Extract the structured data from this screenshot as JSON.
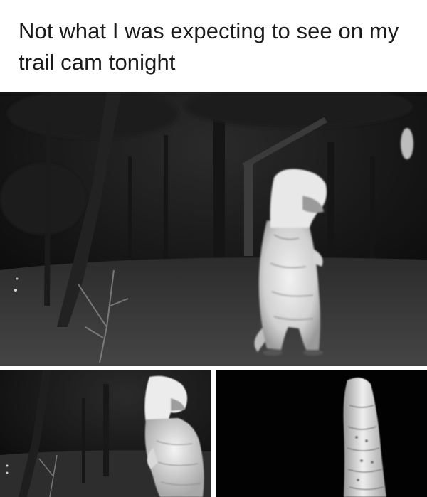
{
  "post": {
    "caption": "Not what I was expecting to see on my trail cam tonight"
  },
  "photos": [
    {
      "scene": "trail-cam-night-dinosaur-costume-full"
    },
    {
      "scene": "trail-cam-night-dinosaur-costume-side"
    },
    {
      "scene": "trail-cam-night-dinosaur-costume-closeup"
    }
  ],
  "colors": {
    "background": "#ffffff",
    "text": "#1a1a1a",
    "night_dark": "#0b0b0b",
    "costume_glow": "#e6e6e6"
  }
}
